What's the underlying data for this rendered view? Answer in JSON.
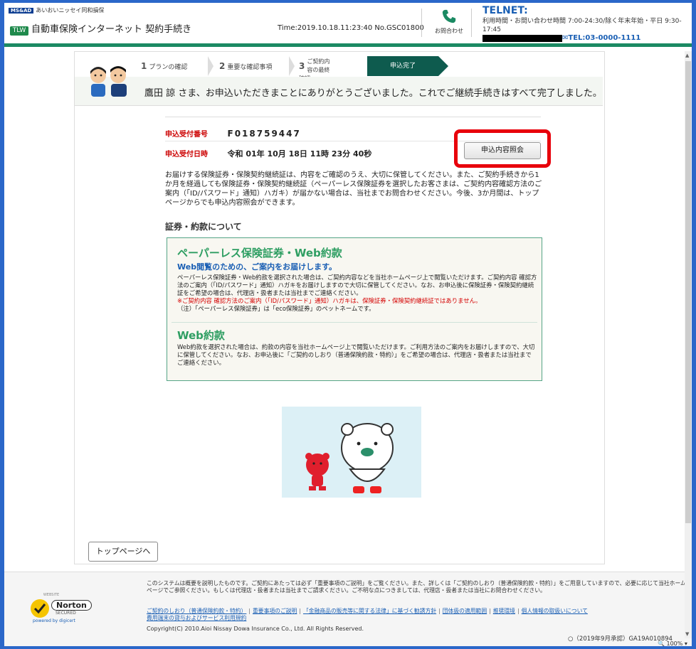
{
  "header": {
    "company_badge": "MS&AD",
    "company_name": "あいおいニッセイ同和損保",
    "app_mark": "TLW",
    "app_title": "自動車保険インターネット 契約手続き",
    "time_info": "Time:2019.10.18.11:23:40 No.GSC01800",
    "inquiry_label": "お問合わせ",
    "telnet_title": "TELNET:",
    "hours": "利用時間・お問い合わせ時間 7:00-24:30/除く年末年始・平日 9:30-17:45",
    "tel": "✉TEL:03-0000-1111"
  },
  "steps": [
    {
      "num": "1",
      "label": "プランの確認"
    },
    {
      "num": "2",
      "label": "重要な確認事項"
    },
    {
      "num": "3",
      "label": "ご契約内容の最終確認"
    },
    {
      "num": "",
      "label": "申込完了"
    }
  ],
  "thanks_text": "鷹田 諒 さま、お申込いただきまことにありがとうございました。これでご継続手続きはすべて完了しました。",
  "receipt": {
    "number_label": "申込受付番号",
    "number_value": "F018759447",
    "date_label": "申込受付日時",
    "date_value": "令和 01年 10月 18日 11時 23分 40秒",
    "inquiry_button": "申込内容照会"
  },
  "notice": "お届けする保険証券・保険契約継続証は、内容をご確認のうえ、大切に保管してください。また、ご契約手続きから1か月を経過しても保険証券・保険契約継続証（ペーパーレス保険証券を選択したお客さまは、ご契約内容確認方法のご案内（「ID/パスワード」通知）ハガキ）が届かない場合は、当社までお問合わせください。今後、3か月間は、トップページからでも申込内容照会ができます。",
  "section_title": "証券・約款について",
  "paperless": {
    "title": "ペーパーレス保険証券・Web約款",
    "subtitle": "Web閲覧のための、ご案内をお届けします。",
    "body": "ペーパーレス保険証券・Web約款を選択された場合は、ご契約内容などを当社ホームページ上で閲覧いただけます。ご契約内容 確認方法のご案内（「ID/パスワード」通知）ハガキをお届けしますので大切に保管してください。なお、お申込後に保険証券・保険契約継続証をご希望の場合は、代理店・扱者または当社までご連絡ください。",
    "red_note": "※ご契約内容 確認方法のご案内（「ID/パスワード」通知）ハガキは、保険証券・保険契約継続証ではありません。",
    "note": "（注）「ペーパーレス保険証券」は「eco保険証券」のペットネームです。"
  },
  "web_yakkan": {
    "title": "Web約款",
    "body": "Web約款を選択された場合は、約款の内容を当社ホームページ上で閲覧いただけます。ご利用方法のご案内をお届けしますので、大切に保管してください。なお、お申込後に「ご契約のしおり（普通保険約款・特約）」をご希望の場合は、代理店・扱者または当社までご連絡ください。"
  },
  "top_button": "トップページへ",
  "footer": {
    "norton_top": "WEBSITE",
    "norton_brand": "Norton",
    "norton_secured": "SECURED",
    "norton_powered": "powered by digicert",
    "note": "このシステムは概要を説明したものです。ご契約にあたっては必ず「重要事項のご説明」をご覧ください。また、詳しくは「ご契約のしおり（普通保険約款・特約）」をご用意していますので、必要に応じて当社ホームページでご参照ください。もしくは代理店・扱者または当社までご請求ください。ご不明な点につきましては、代理店・扱者または当社にお問合わせください。",
    "links": [
      "ご契約のしおり（普通保険約款・特約）",
      "重要事項のご説明",
      "「金融商品の販売等に関する法律」に基づく勧誘方針",
      "団体扱の適用範囲",
      "推奨環境",
      "個人情報の取扱いについて",
      "費用端末の貸与およびサービス利用規約"
    ],
    "copyright": "Copyright(C) 2010.Aioi Nissay Dowa Insurance Co., Ltd. All Rights Reserved.",
    "approval": "○（2019年9月承認）GA19A010894",
    "zoom": "🔍 100%  ▾"
  },
  "colors": {
    "brand_green": "#1b8a63",
    "accent_red": "#e8000b",
    "link_blue": "#1a5fb4"
  }
}
